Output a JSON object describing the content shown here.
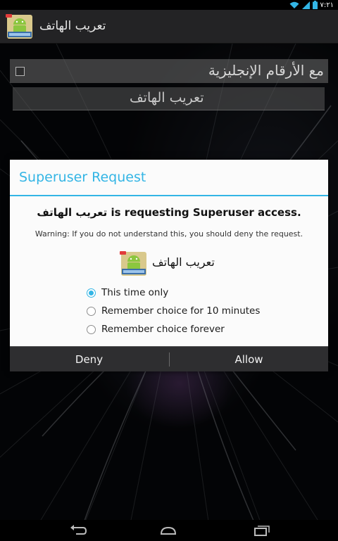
{
  "status_bar": {
    "time": "٧:٢١",
    "icons": [
      "wifi-icon",
      "signal-icon",
      "battery-icon"
    ]
  },
  "action_bar": {
    "title": "تعريب الهاتف",
    "icon": "app-icon"
  },
  "background": {
    "checkbox_label": "مع الأرقام الإنجليزية",
    "checkbox_checked": false,
    "button_label": "تعريب الهاتف"
  },
  "dialog": {
    "title": "Superuser Request",
    "request_text": "تعريب الهاتف is requesting Superuser access.",
    "warning": "Warning: If you do not understand this, you should deny the request.",
    "app_name": "تعريب الهاتف",
    "options": [
      {
        "label": "This time only",
        "checked": true
      },
      {
        "label": "Remember choice for 10 minutes",
        "checked": false
      },
      {
        "label": "Remember choice forever",
        "checked": false
      }
    ],
    "deny_label": "Deny",
    "allow_label": "Allow"
  },
  "nav_bar": {
    "icons": [
      "back-icon",
      "home-icon",
      "recents-icon"
    ]
  },
  "colors": {
    "accent": "#33b5e5",
    "dialog_background": "#fbfbfb",
    "action_bar": "#232325",
    "button_bar": "#2e2e30"
  }
}
